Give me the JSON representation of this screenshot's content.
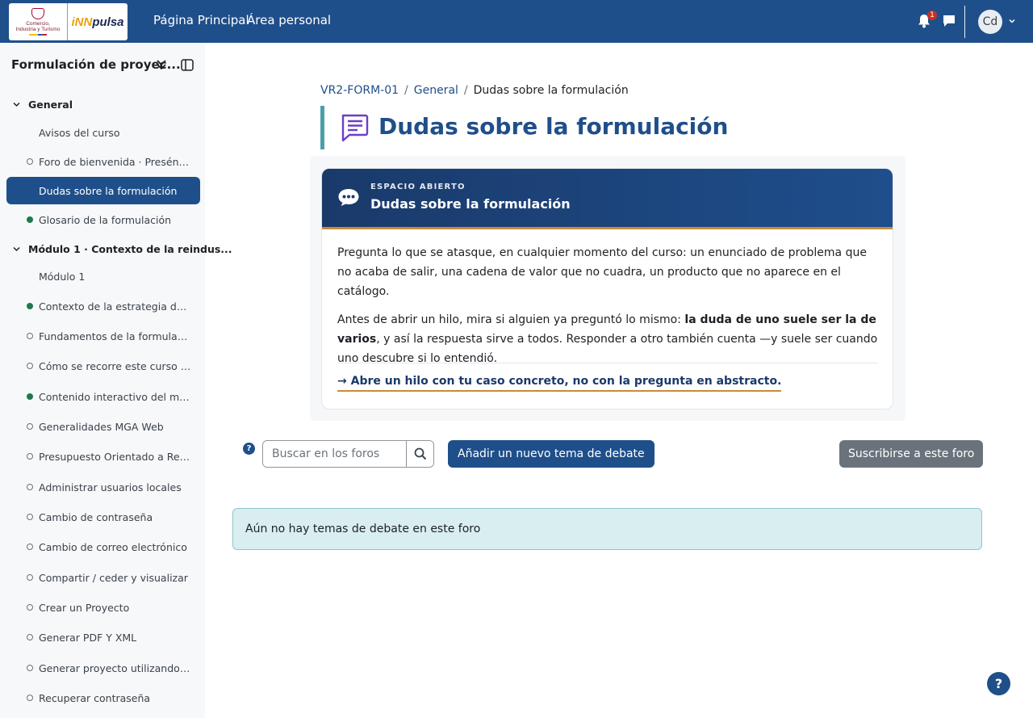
{
  "navbar": {
    "logo": {
      "left_line1": "Comercio,",
      "left_line2": "Industria y Turismo",
      "brand_inn": "iNN",
      "brand_pulsa": "pulsa"
    },
    "links": [
      "Página Principal",
      "Área personal"
    ],
    "notification_count": "1",
    "avatar_initials": "Cd",
    "colors": {
      "bar": "#1f4f8a",
      "badge": "#ca3120"
    }
  },
  "sidebar": {
    "course_title": "Formulación de proyec...",
    "sections": [
      {
        "title": "General",
        "items": [
          {
            "label": "Avisos del curso",
            "status": "none"
          },
          {
            "label": "Foro de bienvenida · Preséntate",
            "status": "empty"
          },
          {
            "label": "Dudas sobre la formulación",
            "status": "none",
            "active": true
          },
          {
            "label": "Glosario de la formulación",
            "status": "done"
          }
        ]
      },
      {
        "title": "Módulo 1 · Contexto de la reindus...",
        "items": [
          {
            "label": "Módulo 1",
            "status": "none"
          },
          {
            "label": "Contexto de la estrategia de rein...",
            "status": "done"
          },
          {
            "label": "Fundamentos de la formulación ...",
            "status": "empty"
          },
          {
            "label": "Cómo se recorre este curso y acc...",
            "status": "empty"
          },
          {
            "label": "Contenido interactivo del módul...",
            "status": "done"
          },
          {
            "label": "Generalidades MGA Web",
            "status": "empty"
          },
          {
            "label": "Presupuesto Orientado a Result...",
            "status": "empty"
          },
          {
            "label": "Administrar usuarios locales",
            "status": "empty"
          },
          {
            "label": "Cambio de contraseña",
            "status": "empty"
          },
          {
            "label": "Cambio de correo electrónico",
            "status": "empty"
          },
          {
            "label": "Compartir / ceder y visualizar",
            "status": "empty"
          },
          {
            "label": "Crear un Proyecto",
            "status": "empty"
          },
          {
            "label": "Generar PDF Y XML",
            "status": "empty"
          },
          {
            "label": "Generar proyecto utilizando proy...",
            "status": "empty"
          },
          {
            "label": "Recuperar contraseña",
            "status": "empty"
          }
        ]
      }
    ]
  },
  "breadcrumb": [
    "VR2-FORM-01",
    "General",
    "Dudas sobre la formulación"
  ],
  "page_title": "Dudas sobre la formulación",
  "card": {
    "kicker": "ESPACIO ABIERTO",
    "title": "Dudas sobre la formulación",
    "paragraph1": "Pregunta lo que se atasque, en cualquier momento del curso: un enunciado de problema que no acaba de salir, una cadena de valor que no cuadra, un producto que no aparece en el catálogo.",
    "paragraph2_before": "Antes de abrir un hilo, mira si alguien ya preguntó lo mismo: ",
    "paragraph2_bold": "la duda de uno suele ser la de varios",
    "paragraph2_after": ", y así la respuesta sirve a todos. Responder a otro también cuenta —y suele ser cuando uno descubre si lo entendió.",
    "cta": "→ Abre un hilo con tu caso concreto, no con la pregunta en abstracto."
  },
  "forum": {
    "search_placeholder": "Buscar en los foros",
    "add_topic": "Añadir un nuevo tema de debate",
    "subscribe": "Suscribirse a este foro",
    "empty_message": "Aún no hay temas de debate en este foro"
  },
  "help_glyph": "?"
}
